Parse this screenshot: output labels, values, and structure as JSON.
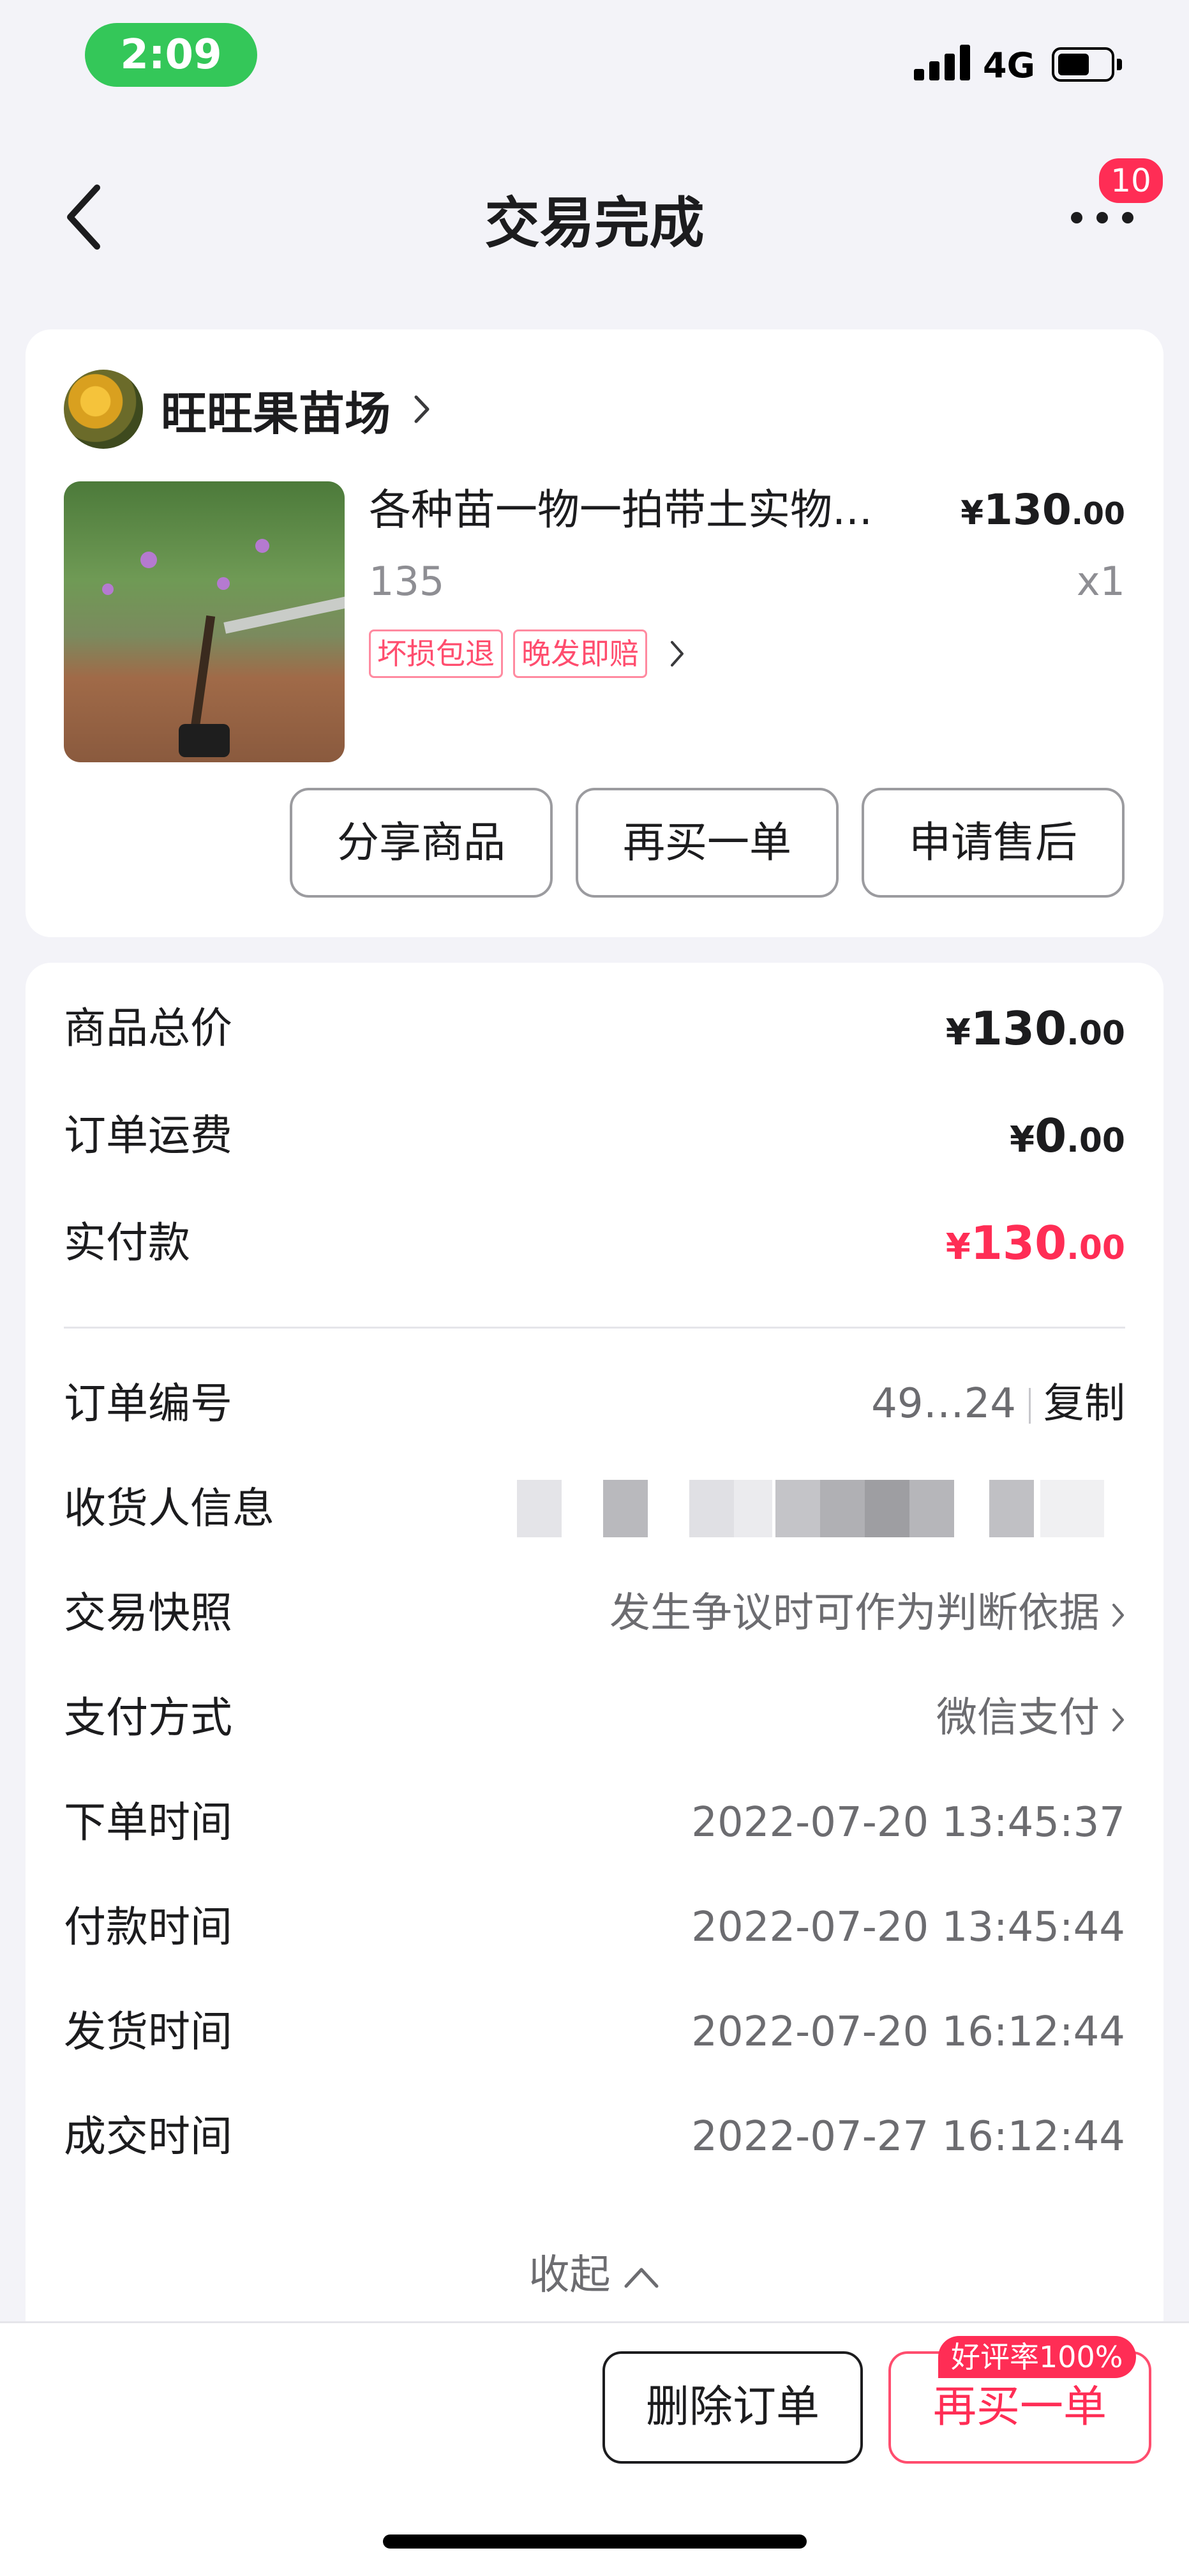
{
  "status_bar": {
    "time": "2:09",
    "network": "4G"
  },
  "nav": {
    "title": "交易完成",
    "badge_count": "10"
  },
  "shop": {
    "name": "旺旺果苗场"
  },
  "product": {
    "title": "各种苗一物一拍带土实物...",
    "price_currency": "¥",
    "price_int": "130",
    "price_dec": ".00",
    "sku": "135",
    "quantity": "x1",
    "tags": [
      "坏损包退",
      "晚发即赔"
    ]
  },
  "actions": {
    "share": "分享商品",
    "rebuy": "再买一单",
    "after_sale": "申请售后"
  },
  "summary": {
    "goods_total_label": "商品总价",
    "goods_total_int": "130",
    "shipping_label": "订单运费",
    "shipping_int": "0",
    "paid_label": "实付款",
    "paid_int": "130",
    "currency": "¥",
    "dec": ".00"
  },
  "details": {
    "order_no_label": "订单编号",
    "order_no_value": "49…24",
    "copy_label": "复制",
    "receiver_label": "收货人信息",
    "snapshot_label": "交易快照",
    "snapshot_value": "发生争议时可作为判断依据",
    "payment_label": "支付方式",
    "payment_value": "微信支付",
    "order_time_label": "下单时间",
    "order_time_value": "2022-07-20 13:45:37",
    "pay_time_label": "付款时间",
    "pay_time_value": "2022-07-20 13:45:44",
    "ship_time_label": "发货时间",
    "ship_time_value": "2022-07-20 16:12:44",
    "deal_time_label": "成交时间",
    "deal_time_value": "2022-07-27 16:12:44",
    "collapse_label": "收起"
  },
  "bottom": {
    "delete": "删除订单",
    "rebuy": "再买一单",
    "rating_badge": "好评率100%"
  },
  "colors": {
    "accent": "#ff2d55",
    "status_green": "#34c759",
    "background": "#f3f3f8"
  }
}
